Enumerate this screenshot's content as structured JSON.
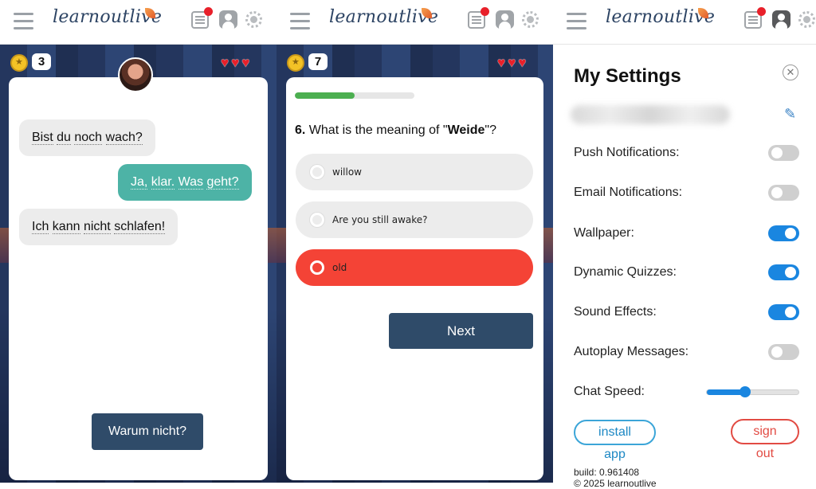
{
  "app": {
    "logo_text": "learnoutlive"
  },
  "chat_panel": {
    "coins": "3",
    "messages": [
      {
        "from": "them",
        "words": [
          "Bist",
          "du",
          "noch",
          "wach?"
        ]
      },
      {
        "from": "me",
        "words": [
          "Ja,",
          "klar.",
          "Was",
          "geht?"
        ]
      },
      {
        "from": "them",
        "words": [
          "Ich",
          "kann",
          "nicht",
          "schlafen!"
        ]
      }
    ],
    "reply_button": "Warum nicht?"
  },
  "quiz_panel": {
    "coins": "7",
    "progress_fraction": 0.5,
    "question_number": "6.",
    "question_prefix": " What is the meaning of \"",
    "question_word": "Weide",
    "question_suffix": "\"?",
    "options": [
      "willow",
      "Are you still awake?",
      "old"
    ],
    "selected_wrong_index": 2,
    "next_button": "Next"
  },
  "settings_panel": {
    "title": "My Settings",
    "close_glyph": "✕",
    "edit_glyph": "✎",
    "rows": {
      "push": "Push Notifications:",
      "email": "Email Notifications:",
      "wallpaper": "Wallpaper:",
      "dynamic": "Dynamic Quizzes:",
      "sound": "Sound Effects:",
      "autoplay": "Autoplay Messages:",
      "speed": "Chat Speed:"
    },
    "toggles": {
      "push": false,
      "email": false,
      "wallpaper": true,
      "dynamic": true,
      "sound": true,
      "autoplay": false
    },
    "chat_speed_fraction": 0.42,
    "install_button": "install app",
    "signout_button": "sign out",
    "build": "build: 0.961408",
    "copyright": "© 2025 learnoutlive"
  },
  "colors": {
    "accent_blue": "#1a86e0",
    "teal_bubble": "#4db3a6",
    "wrong_red": "#f44336",
    "dark_button": "#2f4b69",
    "heart_red": "#e8202a"
  }
}
